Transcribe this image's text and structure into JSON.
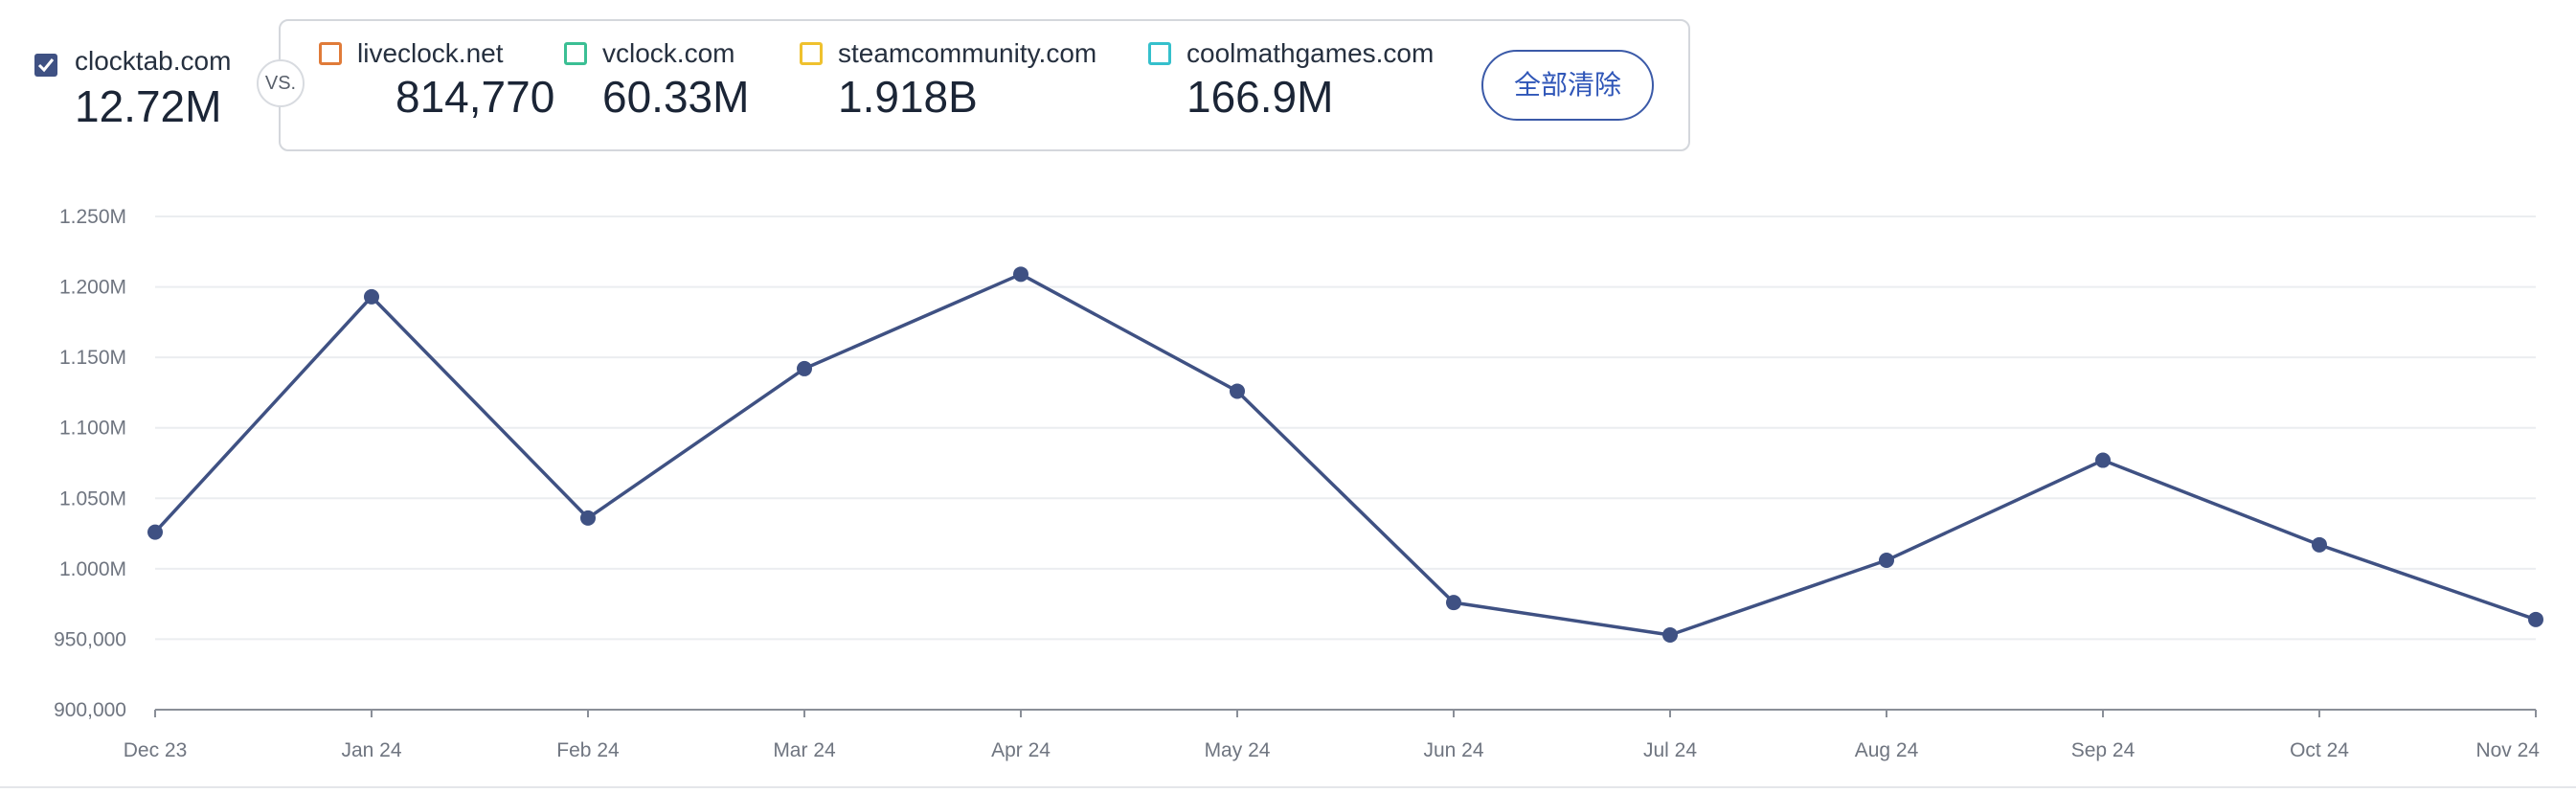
{
  "primary": {
    "name": "clocktab.com",
    "value": "12.72M",
    "checked": true,
    "color": "#3f5183"
  },
  "vs_label": "VS.",
  "comparisons": [
    {
      "name": "liveclock.net",
      "value": "814,770",
      "color": "#e07b39"
    },
    {
      "name": "vclock.com",
      "value": "60.33M",
      "color": "#3bbf94"
    },
    {
      "name": "steamcommunity.com",
      "value": "1.918B",
      "color": "#efc12e"
    },
    {
      "name": "coolmathgames.com",
      "value": "166.9M",
      "color": "#35c0cc"
    }
  ],
  "clear_all_label": "全部清除",
  "chart_data": {
    "type": "line",
    "categories": [
      "Dec 23",
      "Jan 24",
      "Feb 24",
      "Mar 24",
      "Apr 24",
      "May 24",
      "Jun 24",
      "Jul 24",
      "Aug 24",
      "Sep 24",
      "Oct 24",
      "Nov 24"
    ],
    "series": [
      {
        "name": "clocktab.com",
        "color": "#3f5183",
        "values": [
          1026000,
          1193000,
          1036000,
          1142000,
          1209000,
          1126000,
          976000,
          953000,
          1006000,
          1077000,
          1017000,
          964000
        ]
      }
    ],
    "ylim": [
      900000,
      1250000
    ],
    "yticks": [
      900000,
      950000,
      1000000,
      1050000,
      1100000,
      1150000,
      1200000,
      1250000
    ],
    "ytick_labels": [
      "900,000",
      "950,000",
      "1.000M",
      "1.050M",
      "1.100M",
      "1.150M",
      "1.200M",
      "1.250M"
    ],
    "grid": true,
    "legend": "top"
  }
}
